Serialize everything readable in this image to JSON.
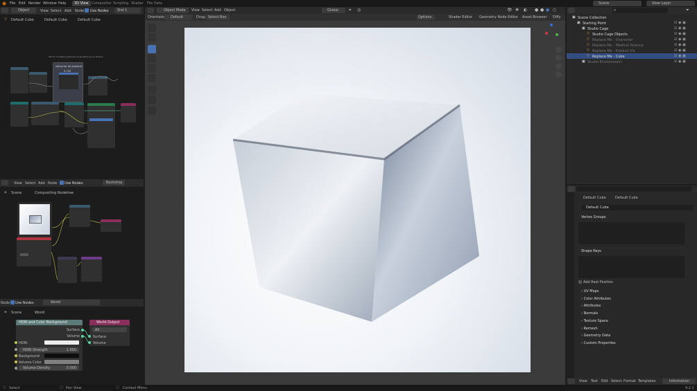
{
  "topbar": {
    "menus": [
      "File",
      "Edit",
      "Render",
      "Window",
      "Help"
    ],
    "tabs": [
      "3D View",
      "Compositor",
      "Scripting",
      "Shader",
      "File Data"
    ],
    "scene": "Scene",
    "view_layer": "View Layer"
  },
  "geo_editor": {
    "mode": "Object",
    "menus": [
      "View",
      "Select",
      "Add",
      "Node"
    ],
    "use_nodes": "Use Nodes",
    "slot": "Slot 1",
    "breadcrumb": [
      "Default Cube",
      "Default Cube",
      "Default Cube"
    ],
    "frame_label": "Adjust for All gradient",
    "frame_sub": "0.720",
    "frame_note": "Set for modifying textures all gradient key & texture"
  },
  "comp_editor": {
    "menus": [
      "View",
      "Select",
      "Add",
      "Node"
    ],
    "use_nodes": "Use Nodes",
    "backdrop": "Backdrop",
    "breadcrumb": [
      "Scene",
      "Compositing Nodetree"
    ]
  },
  "world_editor": {
    "header_label": "Node",
    "use_nodes": "Use Nodes",
    "world": "World",
    "breadcrumb": [
      "Scene",
      "World"
    ],
    "node1": {
      "title": "HDRI and Color Background",
      "out_surface": "Surface",
      "out_volume": "Volume",
      "hdri": "HDRI",
      "hdri_strength_label": "HDRI Strength",
      "hdri_strength": "1.000",
      "background": "Background",
      "volume_color": "Volume Color",
      "volume_density_label": "Volume Density",
      "volume_density": "0.000"
    },
    "node2": {
      "title": "World Output",
      "target": "All",
      "surface": "Surface",
      "volume": "Volume"
    }
  },
  "viewport": {
    "mode": "Object Mode",
    "menus": [
      "View",
      "Select",
      "Add",
      "Object"
    ],
    "transform": "Global",
    "orientation_label": "Orientation:",
    "orientation": "Default",
    "drag_label": "Drag:",
    "drag": "Select Box",
    "options": "Options",
    "shader_editor": "Shader Editor",
    "geometry_node_editor": "Geometry Node Editor",
    "asset_browser": "Asset Browser",
    "tab_extra": "Diffy"
  },
  "outliner": {
    "search_placeholder": "",
    "items": [
      {
        "label": "Scene Collection",
        "indent": 0,
        "dim": false
      },
      {
        "label": "Starting Point",
        "indent": 1,
        "dim": false
      },
      {
        "label": "Studio Cage",
        "indent": 2,
        "dim": false
      },
      {
        "label": "Studio Cage Objects",
        "indent": 3,
        "dim": false
      },
      {
        "label": "Replace Me - Character",
        "indent": 3,
        "dim": true
      },
      {
        "label": "Replace Me - Medical Science",
        "indent": 3,
        "dim": true
      },
      {
        "label": "Replace Me - Product Viz",
        "indent": 3,
        "dim": true
      },
      {
        "label": "Replace Me - Cube",
        "indent": 3,
        "dim": false
      },
      {
        "label": "Studio Environment",
        "indent": 2,
        "dim": true
      }
    ]
  },
  "properties": {
    "breadcrumb": [
      "Default Cube",
      "Default Cube"
    ],
    "mesh_name": "Default Cube",
    "vertex_groups": "Vertex Groups",
    "shape_keys": "Shape Keys",
    "add_rest_position": "Add Rest Position",
    "sections": [
      "UV Maps",
      "Color Attributes",
      "Attributes",
      "Normals",
      "Texture Space",
      "Remesh",
      "Geometry Data",
      "Custom Properties"
    ]
  },
  "text_editor": {
    "menus": [
      "View",
      "Text",
      "Edit",
      "Select",
      "Format",
      "Templates"
    ],
    "info": "Information"
  },
  "statusbar": {
    "items": [
      "Select",
      "Pan View",
      "Context Menu"
    ],
    "version": "4.2.1"
  },
  "colors": {
    "accent": "#4772b3",
    "geometry_node": "#1f6e6e",
    "shader_node": "#2d7a4a",
    "output_node": "#8a2f5c"
  }
}
